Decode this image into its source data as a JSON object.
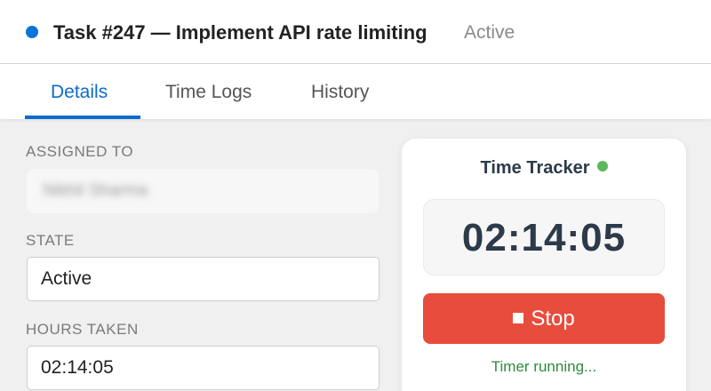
{
  "header": {
    "title": "Task #247 — Implement API rate limiting",
    "state_badge": "Active",
    "status_dot_color": "#0b74d6"
  },
  "tabs": [
    {
      "label": "Details",
      "active": true
    },
    {
      "label": "Time Logs",
      "active": false
    },
    {
      "label": "History",
      "active": false
    }
  ],
  "form": {
    "assigned_label": "ASSIGNED TO",
    "assigned_value": "Nikhil Sharma",
    "state_label": "STATE",
    "state_value": "Active",
    "hours_label": "HOURS TAKEN",
    "hours_value": "02:14:05"
  },
  "tracker": {
    "title": "Time Tracker",
    "live_dot_color": "#5cb85c",
    "elapsed": "02:14:05",
    "stop_label": "Stop",
    "status": "Timer running..."
  },
  "colors": {
    "accent": "#0b6ccd",
    "stop_button": "#e84c3d",
    "running_text": "#2e8b3a"
  }
}
